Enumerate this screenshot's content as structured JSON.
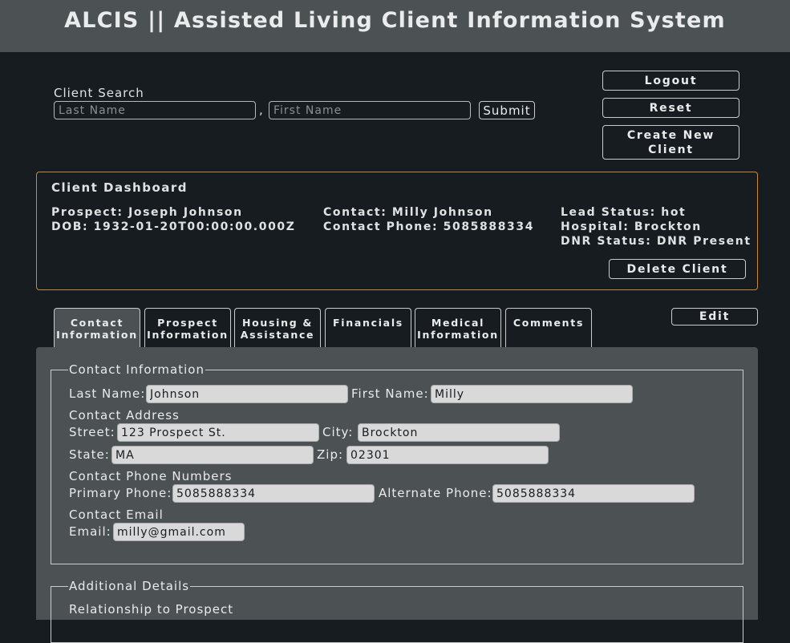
{
  "app": {
    "title": "ALCIS || Assisted Living Client Information System"
  },
  "search": {
    "label": "Client Search",
    "last_placeholder": "Last Name",
    "first_placeholder": "First Name",
    "separator": ",",
    "submit_label": "Submit"
  },
  "actions": {
    "logout": "Logout",
    "reset": "Reset",
    "create_line1": "Create New",
    "create_line2": "Client"
  },
  "dashboard": {
    "title": "Client Dashboard",
    "prospect": "Prospect: Joseph Johnson",
    "dob": "DOB: 1932-01-20T00:00:00.000Z",
    "contact": "Contact: Milly Johnson",
    "contact_phone": "Contact Phone: 5085888334",
    "lead_status": "Lead Status: hot",
    "hospital": "Hospital: Brockton",
    "dnr_status": "DNR Status: DNR Present",
    "delete_label": "Delete Client"
  },
  "tabs": [
    {
      "line1": "Contact",
      "line2": "Information"
    },
    {
      "line1": "Prospect",
      "line2": "Information"
    },
    {
      "line1": "Housing &",
      "line2": "Assistance"
    },
    {
      "line1": "Financials",
      "line2": ""
    },
    {
      "line1": "Medical",
      "line2": "Information"
    },
    {
      "line1": "Comments",
      "line2": ""
    }
  ],
  "edit_label": "Edit",
  "contact_info": {
    "legend": "Contact Information",
    "last_name_label": "Last Name:",
    "last_name": "Johnson",
    "first_name_label": "First Name:",
    "first_name": "Milly",
    "address_heading": "Contact Address",
    "street_label": "Street:",
    "street": "123 Prospect St.",
    "city_label": "City:",
    "city": "Brockton",
    "state_label": "State:",
    "state": "MA",
    "zip_label": "Zip:",
    "zip": "02301",
    "phones_heading": "Contact Phone Numbers",
    "primary_label": "Primary Phone:",
    "primary": "5085888334",
    "alternate_label": "Alternate Phone:",
    "alternate": "5085888334",
    "email_heading": "Contact Email",
    "email_label": "Email:",
    "email": "milly@gmail.com"
  },
  "additional": {
    "legend": "Additional Details",
    "relationship_heading": "Relationship to Prospect"
  }
}
